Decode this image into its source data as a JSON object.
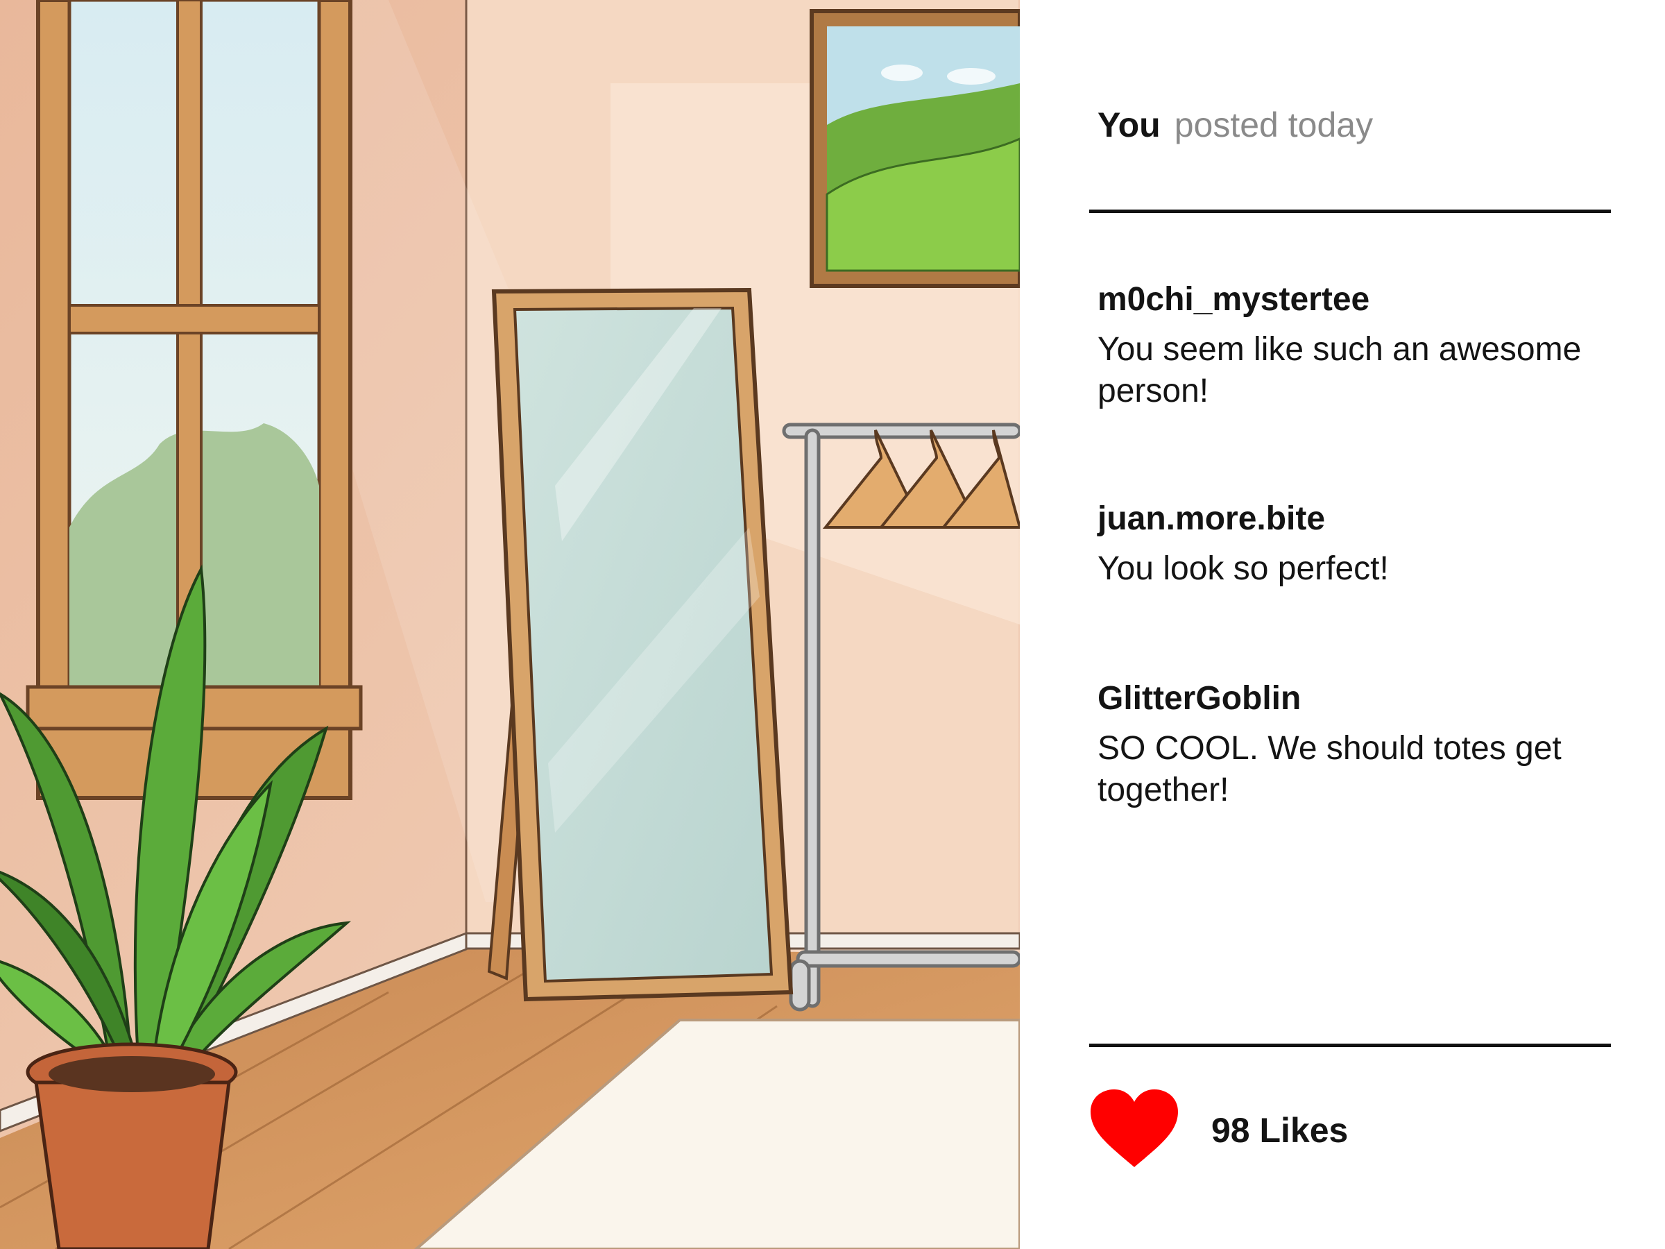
{
  "post": {
    "author": "You",
    "posted_label": "posted today",
    "photo_icon": "room-illustration"
  },
  "comments": [
    {
      "user": "m0chi_mystertee",
      "text": "You seem like such an awesome person!"
    },
    {
      "user": "juan.more.bite",
      "text": "You look so perfect!"
    },
    {
      "user": "GlitterGoblin",
      "text": "SO COOL. We should totes get together!"
    }
  ],
  "likes": {
    "label": "98 Likes",
    "icon": "heart-icon",
    "color": "#ff0000"
  }
}
